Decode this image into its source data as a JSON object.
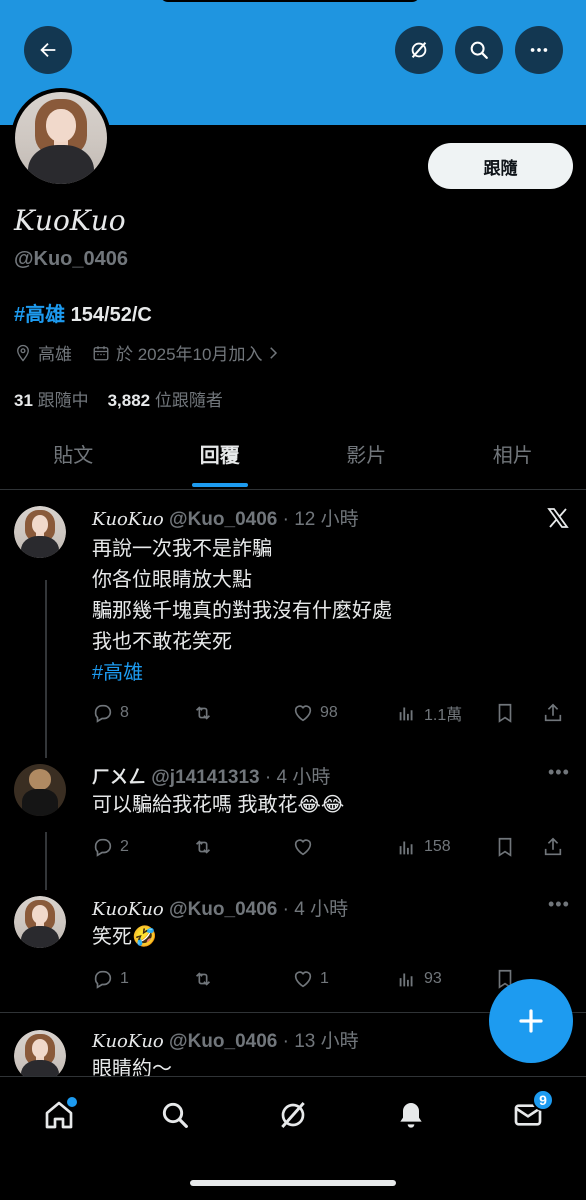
{
  "header": {
    "back_icon": "arrow-left-icon",
    "grok_icon": "grok-icon",
    "search_icon": "search-icon",
    "more_icon": "more-horizontal-icon"
  },
  "profile": {
    "follow_label": "跟隨",
    "display_name": "𝐾𝑢𝑜𝐾𝑢𝑜",
    "handle": "@Kuo_0406",
    "bio_hashtag": "#高雄",
    "bio_text": " 154/52/C",
    "location": "高雄",
    "joined": "於 2025年10月加入",
    "following_count": "31",
    "following_label": "跟隨中",
    "followers_count": "3,882",
    "followers_label": "位跟隨者"
  },
  "tabs": [
    {
      "label": "貼文",
      "active": false
    },
    {
      "label": "回覆",
      "active": true
    },
    {
      "label": "影片",
      "active": false
    },
    {
      "label": "相片",
      "active": false
    }
  ],
  "posts": [
    {
      "name": "𝐾𝑢𝑜𝐾𝑢𝑜",
      "handle": "@Kuo_0406",
      "time": "12 小時",
      "lines": [
        "再說一次我不是詐騙",
        "你各位眼睛放大點",
        "騙那幾千塊真的對我沒有什麼好處",
        "我也不敢花笑死"
      ],
      "hashtag": "#高雄",
      "replies": "8",
      "reposts": "",
      "likes": "98",
      "views": "1.1萬"
    },
    {
      "name": "ㄏㄨㄥ",
      "handle": "@j14141313",
      "time": "4 小時",
      "text": "可以騙給我花嗎  我敢花😂😂",
      "replies": "2",
      "reposts": "",
      "likes": "",
      "views": "158"
    },
    {
      "name": "𝐾𝑢𝑜𝐾𝑢𝑜",
      "handle": "@Kuo_0406",
      "time": "4 小時",
      "text": "笑死🤣",
      "replies": "1",
      "reposts": "",
      "likes": "1",
      "views": "93"
    },
    {
      "name": "𝐾𝑢𝑜𝐾𝑢𝑜",
      "handle": "@Kuo_0406",
      "time": "13 小時",
      "text": "眼睛約～"
    }
  ],
  "bottom_nav": {
    "items": [
      "home-icon",
      "search-icon",
      "grok-icon",
      "notifications-icon",
      "messages-icon"
    ],
    "messages_badge": "9"
  },
  "colors": {
    "accent": "#1d9bf0",
    "banner": "#1f95e0",
    "background": "#000000"
  }
}
